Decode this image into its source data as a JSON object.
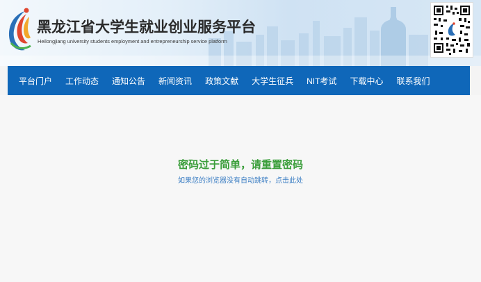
{
  "header": {
    "title": "黑龙江省大学生就业创业服务平台",
    "subtitle": "Heilongjiang university students employment and entrepreneurship service platform"
  },
  "nav": {
    "items": [
      {
        "label": "平台门户"
      },
      {
        "label": "工作动态"
      },
      {
        "label": "通知公告"
      },
      {
        "label": "新闻资讯"
      },
      {
        "label": "政策文献"
      },
      {
        "label": "大学生征兵"
      },
      {
        "label": "NIT考试"
      },
      {
        "label": "下载中心"
      },
      {
        "label": "联系我们"
      }
    ]
  },
  "message": {
    "title": "密码过于简单，请重置密码",
    "redirect_link": "如果您的浏览器没有自动跳转，点击此处"
  },
  "colors": {
    "nav_background": "#0f67b9",
    "message_title": "#3b9e3b",
    "link": "#3d7fc4"
  },
  "icons": {
    "logo": "platform-logo-icon",
    "qr": "qr-code-icon"
  }
}
